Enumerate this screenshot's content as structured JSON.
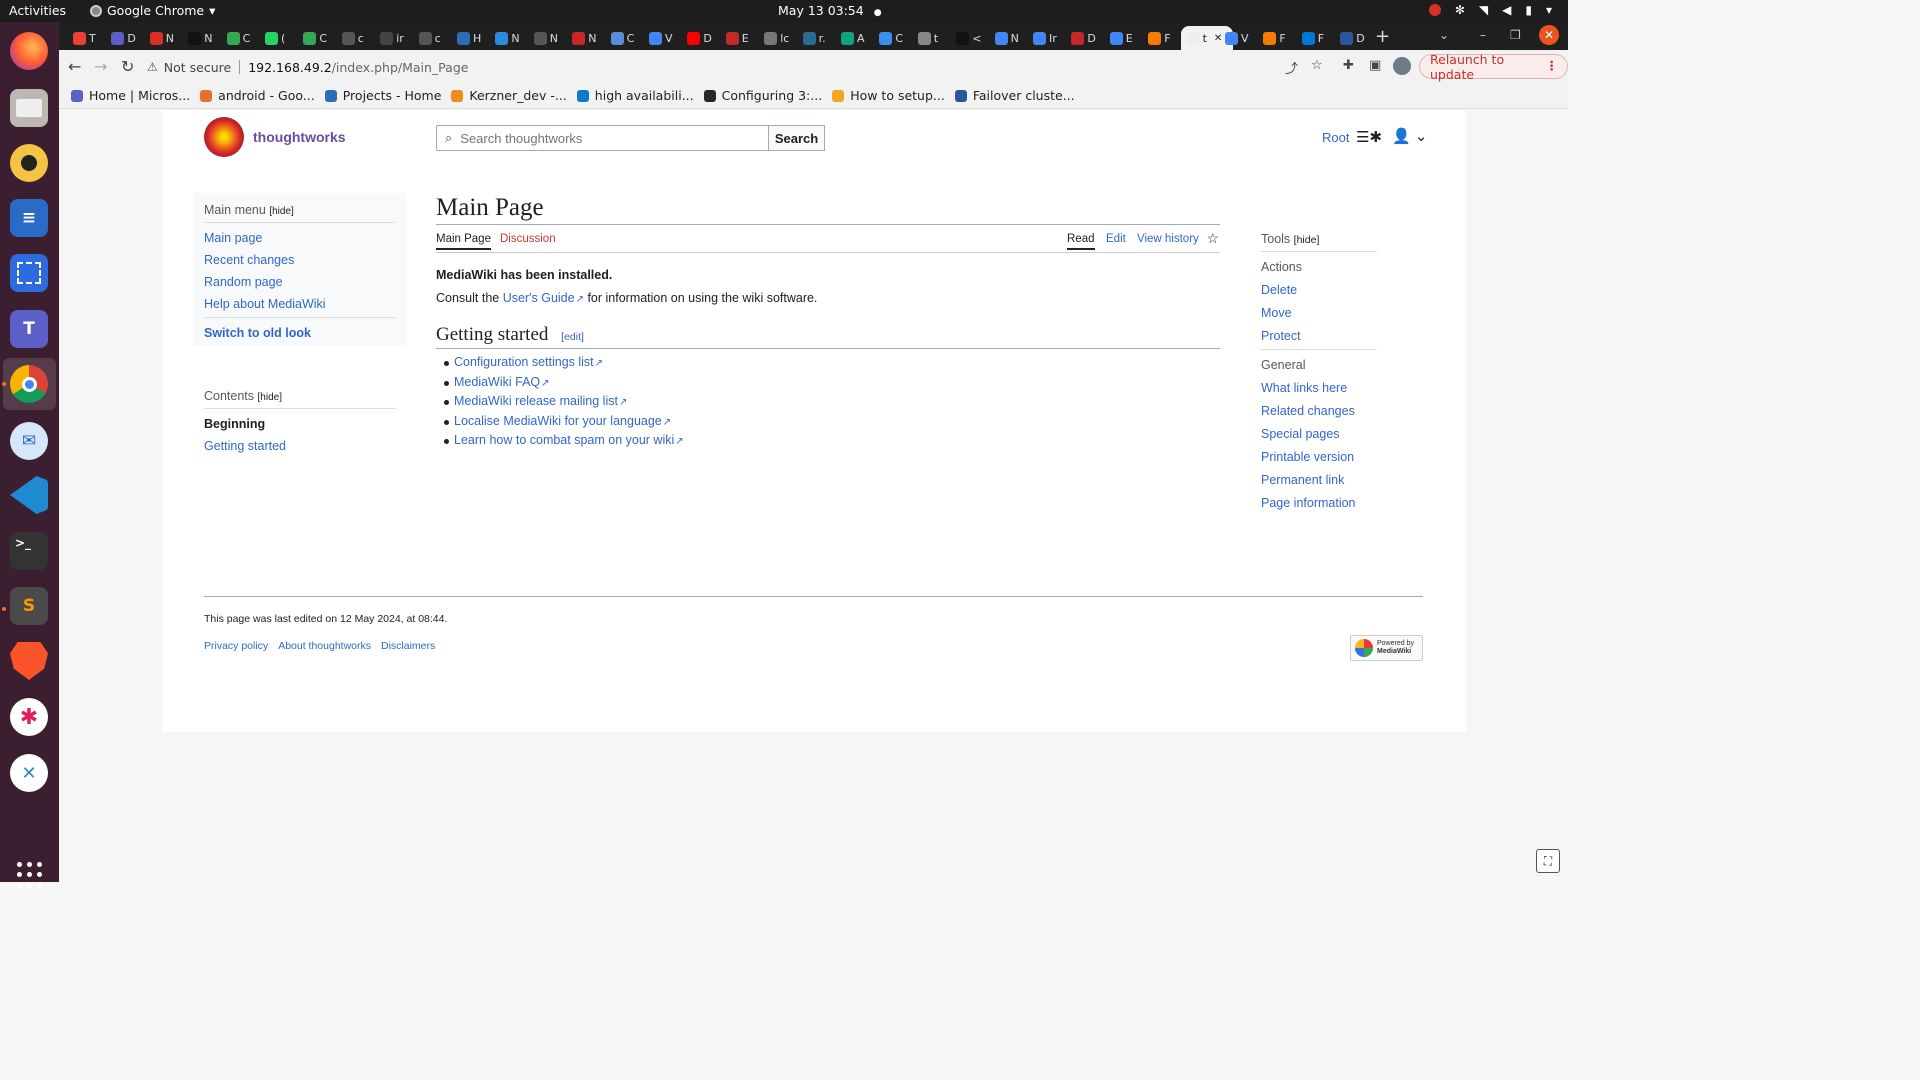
{
  "topbar": {
    "activities": "Activities",
    "app_name": "Google Chrome",
    "app_menu_arrow": "▾",
    "clock": "May 13  03:54",
    "status_dot": "●"
  },
  "dock": {
    "apps": [
      "firefox-icon",
      "files-icon",
      "rhythmbox-icon",
      "writer-icon",
      "screenshot-icon",
      "teams-icon",
      "chrome-icon",
      "mail-icon",
      "vscode-icon",
      "terminal-icon",
      "sublime-icon",
      "brave-icon",
      "slack-icon",
      "remmina-icon"
    ]
  },
  "tabs": {
    "items": [
      "T",
      "D",
      "N",
      "N",
      "C",
      "(",
      "C",
      "c",
      "ir",
      "c",
      "H",
      "N",
      "N",
      "N",
      "C",
      "V",
      "D",
      "E",
      "lc",
      "r.",
      "A",
      "C",
      "t",
      "<",
      "N",
      "Ir",
      "D",
      "E",
      "F",
      "t",
      "V",
      "F",
      "F",
      "D"
    ],
    "active_index": 29,
    "close": "✕",
    "new_tab": "+"
  },
  "toolbar": {
    "warning": "⚠",
    "not_secure": "Not secure",
    "host": "192.168.49.2",
    "path": "/index.php/Main_Page",
    "relaunch": "Relaunch to update",
    "kebab": "⋮"
  },
  "bookmarks": [
    {
      "label": "Home | Micros...",
      "color": "#5b5fc7"
    },
    {
      "label": "android - Goo...",
      "color": "#e8702a"
    },
    {
      "label": "Projects - Home",
      "color": "#2d6db5"
    },
    {
      "label": "Kerzner_dev -...",
      "color": "#f08c1a"
    },
    {
      "label": "high availabili...",
      "color": "#0a7acc"
    },
    {
      "label": "Configuring 3:...",
      "color": "#24292e"
    },
    {
      "label": "How to setup...",
      "color": "#f5a623"
    },
    {
      "label": "Failover cluste...",
      "color": "#2b579a"
    }
  ],
  "wiki": {
    "site_name": "thoughtworks",
    "search_placeholder": "Search thoughtworks",
    "search_button": "Search",
    "user": "Root",
    "main_menu": {
      "title": "Main menu",
      "hide": "[hide]",
      "items": [
        "Main page",
        "Recent changes",
        "Random page",
        "Help about MediaWiki"
      ],
      "switch": "Switch to old look"
    },
    "contents": {
      "title": "Contents",
      "hide": "[hide]",
      "items": [
        "Beginning",
        "Getting started"
      ]
    },
    "page_title": "Main Page",
    "page_tabs": {
      "main": "Main Page",
      "discussion": "Discussion",
      "read": "Read",
      "edit": "Edit",
      "history": "View history"
    },
    "installed": "MediaWiki has been installed.",
    "consult_pre": "Consult the ",
    "consult_link": "User's Guide",
    "consult_post": " for information on using the wiki software.",
    "section_title": "Getting started",
    "section_edit_open": "[",
    "section_edit": "edit",
    "section_edit_close": "]",
    "links": [
      "Configuration settings list",
      "MediaWiki FAQ",
      "MediaWiki release mailing list",
      "Localise MediaWiki for your language",
      "Learn how to combat spam on your wiki"
    ],
    "tools": {
      "title": "Tools",
      "hide": "[hide]",
      "actions_label": "Actions",
      "actions": [
        "Delete",
        "Move",
        "Protect"
      ],
      "general_label": "General",
      "general": [
        "What links here",
        "Related changes",
        "Special pages",
        "Printable version",
        "Permanent link",
        "Page information"
      ]
    },
    "footer": {
      "last_edited": "This page was last edited on 12 May 2024, at 08:44.",
      "links": [
        "Privacy policy",
        "About thoughtworks",
        "Disclaimers"
      ],
      "powered_1": "Powered by",
      "powered_2": "MediaWiki"
    }
  }
}
